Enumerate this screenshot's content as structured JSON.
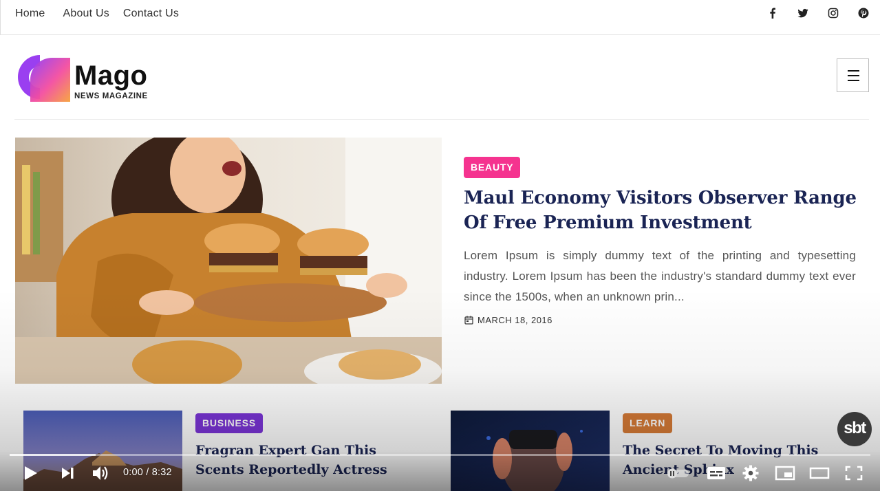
{
  "top_nav": {
    "items": [
      {
        "label": "Home"
      },
      {
        "label": "About Us"
      },
      {
        "label": "Contact Us"
      }
    ],
    "social_icons": [
      "facebook-icon",
      "twitter-icon",
      "instagram-icon",
      "pinterest-icon"
    ]
  },
  "brand": {
    "name": "Mago",
    "tagline": "NEWS MAGAZINE",
    "colors": {
      "gradient_start": "#8f3cf7",
      "gradient_mid": "#f34da0",
      "gradient_end": "#f6a23a"
    }
  },
  "feature": {
    "category": "BEAUTY",
    "category_color": "#f5338f",
    "title": "Maul Economy Visitors Observer Range Of Free Premium Investment",
    "excerpt": "Lorem Ipsum is simply dummy text of the printing and typesetting industry. Lorem Ipsum has been the industry's standard dummy text ever since the 1500s, when an unknown prin...",
    "date": "MARCH 18, 2016"
  },
  "cards": [
    {
      "category": "BUSINESS",
      "category_color": "#7a34d6",
      "title": "Fragran Expert Gan This Scents Reportedly Actress"
    },
    {
      "category": "LEARN",
      "category_color": "#d57a36",
      "title": "The Secret To Moving This Ancient Sphinx"
    }
  ],
  "video_player": {
    "time_display": "0:00 / 8:32",
    "channel_watermark": "sbt",
    "buffered_fraction": 0.1
  }
}
